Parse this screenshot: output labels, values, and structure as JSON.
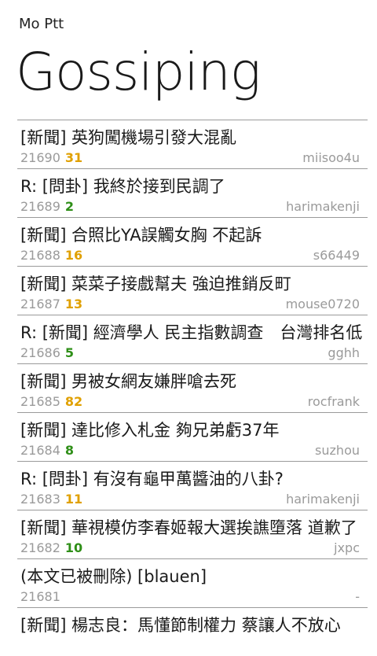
{
  "header": {
    "app_name": "Mo Ptt",
    "title": "Gossiping"
  },
  "colors": {
    "push_high": "#e0a000",
    "push_low": "#2f8f18",
    "meta": "#9a9a9a"
  },
  "articles": [
    {
      "title": "[新聞] 英狗闖機場引發大混亂",
      "id": "21690",
      "push": "31",
      "push_level": "high",
      "author": "miisoo4u"
    },
    {
      "title": "R: [問卦] 我終於接到民調了",
      "id": "21689",
      "push": "2",
      "push_level": "low",
      "author": "harimakenji"
    },
    {
      "title": "[新聞] 合照比YA誤觸女胸 不起訴",
      "id": "21688",
      "push": "16",
      "push_level": "high",
      "author": "s66449"
    },
    {
      "title": "[新聞] 菜菜子接戲幫夫 強迫推銷反町",
      "id": "21687",
      "push": "13",
      "push_level": "high",
      "author": "mouse0720"
    },
    {
      "title": "R: [新聞] 經濟學人 民主指數調查　台灣排名低",
      "id": "21686",
      "push": "5",
      "push_level": "low",
      "author": "gghh"
    },
    {
      "title": "[新聞] 男被女網友嫌胖嗆去死",
      "id": "21685",
      "push": "82",
      "push_level": "high",
      "author": "rocfrank"
    },
    {
      "title": "[新聞] 達比修入札金 夠兄弟虧37年",
      "id": "21684",
      "push": "8",
      "push_level": "low",
      "author": "suzhou"
    },
    {
      "title": "R: [問卦] 有沒有龜甲萬醬油的八卦?",
      "id": "21683",
      "push": "11",
      "push_level": "high",
      "author": "harimakenji"
    },
    {
      "title": "[新聞] 華視模仿李春姬報大選挨譙墮落 道歉了",
      "id": "21682",
      "push": "10",
      "push_level": "low",
      "author": "jxpc"
    },
    {
      "title": "(本文已被刪除) [blauen]",
      "id": "21681",
      "push": "",
      "push_level": "",
      "author": "-"
    },
    {
      "title": "[新聞] 楊志良：馬懂節制權力 蔡讓人不放心",
      "id": "",
      "push": "",
      "push_level": "",
      "author": ""
    }
  ]
}
